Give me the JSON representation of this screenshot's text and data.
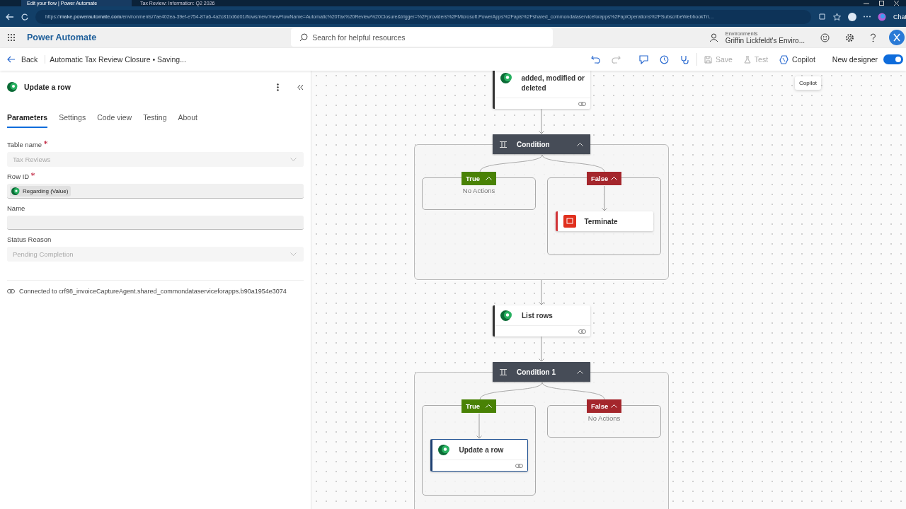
{
  "browser": {
    "tabs": [
      {
        "title": "Edit your flow | Power Automate",
        "selected": true
      },
      {
        "title": "Tax Review: Information: Q2 2026",
        "selected": false
      }
    ],
    "url": "https://**make.powerautomate.com**/environments/7ae402ea-39ef-e754-87a6-4a2c81bd6d01/flows/new?newFlowName=Automatic%20Tax%20Review%20Closure&trigger=%2Fproviders%2FMicrosoft.PowerApps%2Fapis%2Fshared_commondataserviceforapps%2FapiOperations%2FSubscribeWebhookTri…",
    "side_label": "Chat"
  },
  "app": {
    "name": "Power Automate",
    "search": {
      "placeholder": "Search for helpful resources"
    },
    "environment": {
      "label": "Environments",
      "value": "Griffin Lickfeldt's Enviro..."
    }
  },
  "command_bar": {
    "back": "Back",
    "flow_title": "Automatic Tax Review Closure • Saving...",
    "icons": [
      {
        "kind": "undo",
        "disabled": false
      },
      {
        "kind": "redo",
        "disabled": true
      },
      {
        "kind": "assistant",
        "disabled": false
      },
      {
        "kind": "history",
        "disabled": false
      },
      {
        "kind": "checker",
        "disabled": false
      }
    ],
    "buttons": [
      {
        "label": "Save",
        "kind": "save",
        "disabled": true
      },
      {
        "label": "Test",
        "kind": "test",
        "disabled": true
      },
      {
        "label": "Copilot",
        "kind": "copilot",
        "disabled": false
      }
    ],
    "designer_toggle": {
      "label": "New designer",
      "on": true
    },
    "tooltip": "Copilot"
  },
  "panel": {
    "title": "Update a row",
    "tabs": [
      {
        "label": "Parameters",
        "selected": true
      },
      {
        "label": "Settings",
        "selected": false
      },
      {
        "label": "Code view",
        "selected": false
      },
      {
        "label": "Testing",
        "selected": false
      },
      {
        "label": "About",
        "selected": false
      }
    ],
    "fields": [
      {
        "label": "Table name",
        "required": true,
        "kind": "dropdown",
        "value": "Tax Reviews",
        "disabled": true
      },
      {
        "label": "Row ID",
        "required": true,
        "kind": "token",
        "value": "Regarding (Value)",
        "disabled": false
      },
      {
        "label": "Name",
        "required": false,
        "kind": "text",
        "disabled": false
      },
      {
        "label": "Status Reason",
        "required": false,
        "kind": "dropdown",
        "value": "Pending Completion",
        "disabled": true
      }
    ],
    "connection": "Connected to crf98_invoiceCaptureAgent.shared_commondataserviceforapps.b90a1954e3074"
  },
  "flow": [
    {
      "kind": "dataverse",
      "title": "added, modified or deleted",
      "selected": false
    },
    {
      "kind": "condition",
      "title": "Condition",
      "expanded": true,
      "branches": [
        {
          "label": "True",
          "kind": "true",
          "expanded": true,
          "empty_text": "No Actions"
        },
        {
          "label": "False",
          "kind": "false",
          "expanded": true,
          "actions": [
            {
              "kind": "terminate",
              "title": "Terminate",
              "selected": false
            }
          ]
        }
      ]
    },
    {
      "kind": "dataverse",
      "title": "List rows",
      "selected": false
    },
    {
      "kind": "condition",
      "title": "Condition 1",
      "expanded": true,
      "branches": [
        {
          "label": "True",
          "kind": "true",
          "expanded": true,
          "actions": [
            {
              "kind": "dataverse",
              "title": "Update a row",
              "selected": true
            }
          ]
        },
        {
          "label": "False",
          "kind": "false",
          "expanded": true,
          "empty_text": "No Actions"
        }
      ]
    }
  ]
}
